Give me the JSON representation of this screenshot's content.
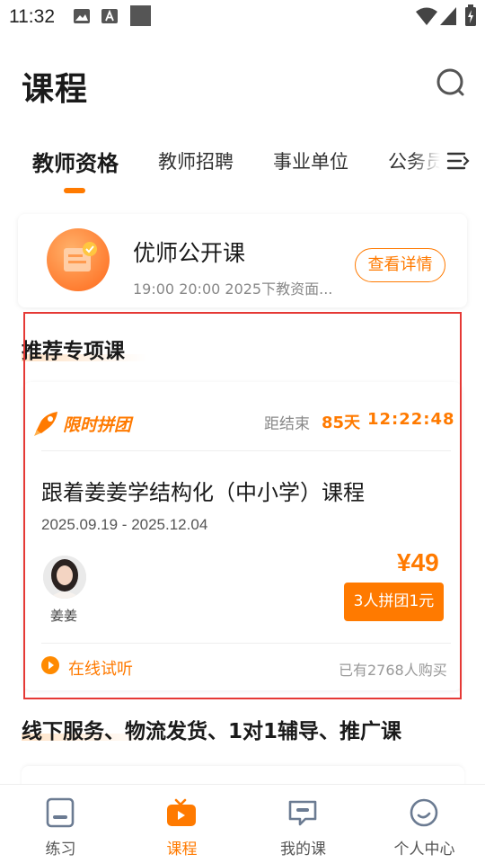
{
  "status_bar": {
    "time": "11:32"
  },
  "header": {
    "title": "课程"
  },
  "tabs": [
    {
      "label": "教师资格"
    },
    {
      "label": "教师招聘"
    },
    {
      "label": "事业单位"
    },
    {
      "label": "公务员"
    }
  ],
  "open_class": {
    "title": "优师公开课",
    "subtitle": "19:00 20:00 2025下教资面...",
    "button": "查看详情"
  },
  "recommended": {
    "section_title": "推荐专项课",
    "promo_logo": "限时拼团",
    "countdown_label": "距结束",
    "countdown_days": "85天",
    "countdown_time": "12:22:48",
    "course_title": "跟着姜姜学结构化（中小学）课程",
    "course_date": "2025.09.19 - 2025.12.04",
    "teacher_name": "姜姜",
    "price": "¥49",
    "group_button": "3人拼团1元",
    "trial_label": "在线试听",
    "bought_count": "已有2768人购买"
  },
  "next_section": {
    "title": "线下服务、物流发货、1对1辅导、推广课"
  },
  "bottom_nav": [
    {
      "label": "练习",
      "icon": "practice-icon",
      "active": false
    },
    {
      "label": "课程",
      "icon": "course-tv-icon",
      "active": true
    },
    {
      "label": "我的课",
      "icon": "my-course-chat-icon",
      "active": false
    },
    {
      "label": "个人中心",
      "icon": "profile-icon",
      "active": false
    }
  ],
  "colors": {
    "accent": "#ff7a00",
    "highlight_border": "#e53935"
  }
}
